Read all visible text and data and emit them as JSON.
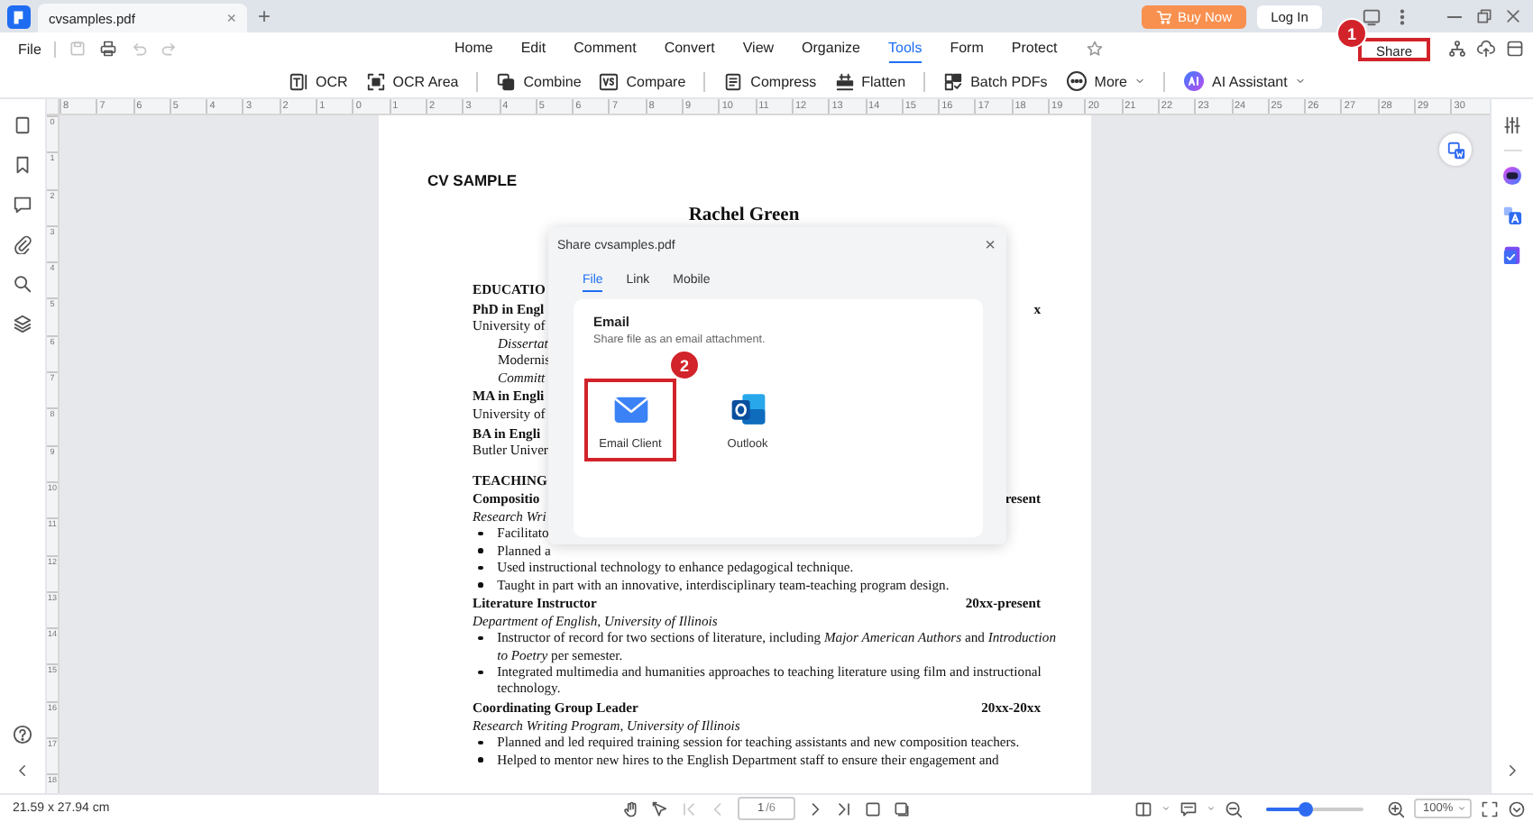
{
  "tab_bar": {
    "tab_title": "cvsamples.pdf",
    "tab_close": "×",
    "new_tab": "+",
    "buy_button": "Buy Now",
    "login_button": "Log In"
  },
  "menu_bar": {
    "file": "File",
    "quick_actions": [
      {
        "kind": "save",
        "disabled": true
      },
      {
        "kind": "print",
        "disabled": false
      },
      {
        "kind": "undo",
        "disabled": true
      },
      {
        "kind": "redo",
        "disabled": true
      }
    ],
    "items": [
      {
        "label": "Home",
        "selected": false
      },
      {
        "label": "Edit",
        "selected": false
      },
      {
        "label": "Comment",
        "selected": false
      },
      {
        "label": "Convert",
        "selected": false
      },
      {
        "label": "View",
        "selected": false
      },
      {
        "label": "Organize",
        "selected": false
      },
      {
        "label": "Tools",
        "selected": true
      },
      {
        "label": "Form",
        "selected": false
      },
      {
        "label": "Protect",
        "selected": false
      }
    ],
    "share_button": {
      "label": "Share",
      "highlighted": true,
      "step": "1"
    }
  },
  "toolbar": {
    "tools": [
      {
        "label": "OCR",
        "kind": "ocr",
        "dropdown": false,
        "divider_after": false
      },
      {
        "label": "OCR Area",
        "kind": "ocr-area",
        "dropdown": false,
        "divider_after": true
      },
      {
        "label": "Combine",
        "kind": "combine",
        "dropdown": false,
        "divider_after": false
      },
      {
        "label": "Compare",
        "kind": "compare",
        "dropdown": false,
        "divider_after": true
      },
      {
        "label": "Compress",
        "kind": "compress",
        "dropdown": false,
        "divider_after": false
      },
      {
        "label": "Flatten",
        "kind": "flatten",
        "dropdown": false,
        "divider_after": true
      },
      {
        "label": "Batch PDFs",
        "kind": "batch",
        "dropdown": false,
        "divider_after": false
      },
      {
        "label": "More",
        "kind": "more",
        "dropdown": true,
        "divider_after": true
      },
      {
        "label": "AI Assistant",
        "kind": "ai",
        "dropdown": true,
        "divider_after": false
      }
    ]
  },
  "ruler": {
    "horizontal": [
      "8",
      "7",
      "6",
      "5",
      "4",
      "3",
      "2",
      "1",
      "0",
      "1",
      "2",
      "3",
      "4",
      "5",
      "6",
      "7",
      "8",
      "9",
      "10",
      "11",
      "12",
      "13",
      "14",
      "15",
      "16",
      "17",
      "18",
      "19",
      "20",
      "21",
      "22",
      "23",
      "24",
      "25",
      "26",
      "27",
      "28",
      "29",
      "30"
    ],
    "vertical": [
      "0",
      "1",
      "2",
      "3",
      "4",
      "5",
      "6",
      "7",
      "8",
      "9",
      "10",
      "11",
      "12",
      "13",
      "14",
      "15",
      "16",
      "17",
      "18"
    ]
  },
  "document": {
    "heading": "CV SAMPLE",
    "name": "Rachel Green",
    "lines": [
      {
        "kind": "section",
        "text": "EDUCATIO"
      },
      {
        "kind": "role",
        "text": "PhD in Engl",
        "date": "x"
      },
      {
        "kind": "text",
        "text": "University of"
      },
      {
        "kind": "indent-note",
        "text": "Dissertat"
      },
      {
        "kind": "indent",
        "text": "Modernis"
      },
      {
        "kind": "indent-note",
        "text": "Committ"
      },
      {
        "kind": "role",
        "text": "MA in Engli"
      },
      {
        "kind": "text",
        "text": "University of"
      },
      {
        "kind": "role",
        "text": "BA in Engli"
      },
      {
        "kind": "text",
        "text": "Butler Univer"
      },
      {
        "kind": "section",
        "text": "TEACHING"
      },
      {
        "kind": "role",
        "text": "Compositio",
        "date": "resent"
      },
      {
        "kind": "note",
        "text": "Research Wri"
      },
      {
        "kind": "bullet",
        "text": "Facilitato"
      },
      {
        "kind": "bullet",
        "text": "Planned a"
      },
      {
        "kind": "bullet",
        "text": "Used instructional technology to enhance pedagogical technique."
      },
      {
        "kind": "bullet",
        "text": "Taught in part with an innovative, interdisciplinary team-teaching program design."
      },
      {
        "kind": "role",
        "text": "Literature Instructor",
        "date": "20xx-present"
      },
      {
        "kind": "note",
        "text": "Department of English, University of Illinois"
      },
      {
        "kind": "bullet",
        "text": "Instructor of record for two sections of literature, including *Major American Authors* and *Introduction to Poetry* per semester."
      },
      {
        "kind": "bullet",
        "text": "Integrated multimedia and humanities approaches to teaching literature using film and instructional technology."
      },
      {
        "kind": "role",
        "text": "Coordinating Group Leader",
        "date": "20xx-20xx"
      },
      {
        "kind": "note",
        "text": "Research Writing Program, University of Illinois"
      },
      {
        "kind": "bullet",
        "text": "Planned and led required training session for teaching assistants and new composition teachers."
      },
      {
        "kind": "bullet",
        "text": "Helped to mentor new hires to the English Department staff to ensure their engagement and"
      }
    ]
  },
  "share_dialog": {
    "title": "Share cvsamples.pdf",
    "close": "×",
    "tabs": [
      {
        "label": "File",
        "selected": true
      },
      {
        "label": "Link",
        "selected": false
      },
      {
        "label": "Mobile",
        "selected": false
      }
    ],
    "section_title": "Email",
    "section_hint": "Share file as an email attachment.",
    "options": [
      {
        "label": "Email Client",
        "kind": "mail",
        "highlighted": true,
        "step": "2"
      },
      {
        "label": "Outlook",
        "kind": "outlook",
        "highlighted": false
      }
    ]
  },
  "status_bar": {
    "page_size": "21.59 x 27.94 cm",
    "nav": [
      {
        "kind": "first",
        "disabled": true
      },
      {
        "kind": "prev",
        "disabled": true
      }
    ],
    "nav_after": [
      {
        "kind": "next",
        "disabled": false
      },
      {
        "kind": "last",
        "disabled": false
      }
    ],
    "page_field": "1",
    "page_total": "/6",
    "zoom": {
      "level": 0.4
    },
    "zoom_value": "100%"
  }
}
